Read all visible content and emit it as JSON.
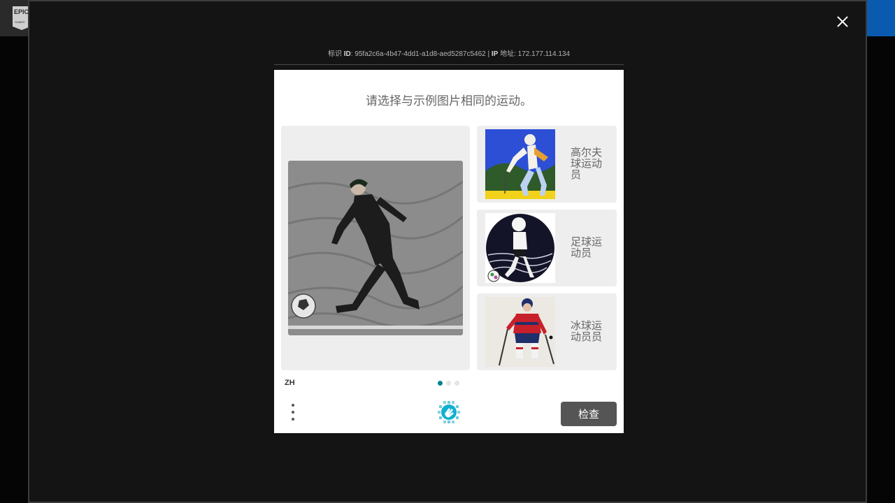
{
  "background": {
    "logo_text": "EPIC GAMES"
  },
  "modal": {
    "meta": {
      "id_prefix": "标识",
      "id_label": "ID",
      "id_value": "95fa2c6a-4b47-4dd1-a1d8-aed5287c5462",
      "separator": "|",
      "ip_label": "IP",
      "ip_suffix": "地址",
      "ip_value": "172.177.114.134"
    },
    "captcha": {
      "title": "请选择与示例图片相同的运动。",
      "main_image": "soccer-player-kicking-ball-sketch",
      "options": [
        {
          "label": "高尔夫球运动员",
          "image": "golfer-illustration"
        },
        {
          "label": "足球运动员",
          "image": "soccer-player-illustration"
        },
        {
          "label": "冰球运动员员",
          "image": "hockey-player-illustration"
        }
      ],
      "language": "ZH",
      "pagination": {
        "total": 3,
        "active": 1
      },
      "submit_label": "检查"
    }
  },
  "colors": {
    "modal_bg": "#141414",
    "accent_teal": "#00838f",
    "button_gray": "#555555",
    "header_blue": "#0a5bb0"
  }
}
